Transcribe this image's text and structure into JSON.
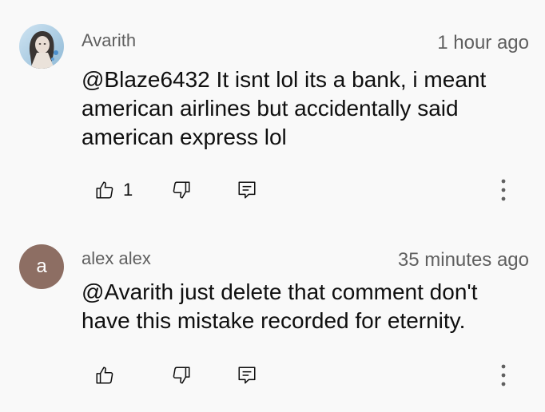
{
  "comments": [
    {
      "author": "Avarith",
      "timestamp": "1 hour ago",
      "text": "@Blaze6432  It isnt lol its a bank, i meant american airlines but accidentally said american express lol",
      "like_count": "1",
      "avatar": {
        "type": "image",
        "icon": "user-photo-avatar"
      }
    },
    {
      "author": "alex alex",
      "timestamp": "35 minutes ago",
      "text": "@Avarith just delete that comment don't have this mistake recorded for eternity.",
      "like_count": "",
      "avatar": {
        "type": "letter",
        "letter": "a",
        "color": "#8d6e63"
      }
    }
  ],
  "icons": {
    "like": "thumbs-up-icon",
    "dislike": "thumbs-down-icon",
    "reply": "reply-comment-icon",
    "more": "more-vertical-icon"
  },
  "colors": {
    "background": "#f9f9f9",
    "text": "#0f0f0f",
    "meta": "#606060"
  }
}
